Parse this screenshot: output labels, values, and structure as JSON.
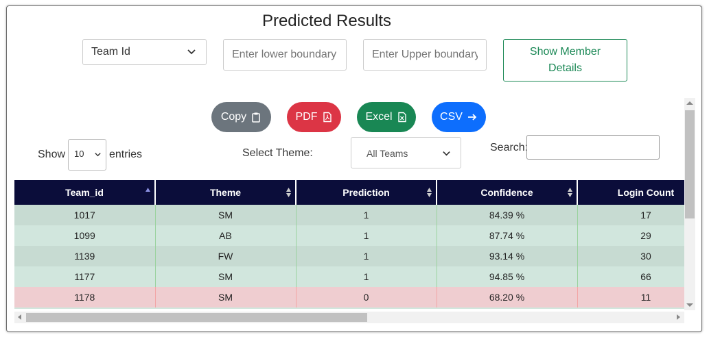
{
  "page": {
    "title": "Predicted Results"
  },
  "filters": {
    "field_select": "Team Id",
    "lower_placeholder": "Enter lower boundary",
    "upper_placeholder": "Enter Upper boundary",
    "show_member_line1": "Show Member",
    "show_member_line2": "Details"
  },
  "export": {
    "copy": "Copy",
    "pdf": "PDF",
    "excel": "Excel",
    "csv": "CSV",
    "colors": {
      "copy": "#6c757d",
      "pdf": "#dc3545",
      "excel": "#198754",
      "csv": "#0d6efd"
    }
  },
  "controls": {
    "show_label": "Show",
    "entries_value": "10",
    "entries_label": "entries",
    "theme_label": "Select Theme:",
    "theme_value": "All Teams",
    "search_label": "Search:",
    "search_value": ""
  },
  "table": {
    "columns": [
      "Team_id",
      "Theme",
      "Prediction",
      "Confidence",
      "Login Count"
    ],
    "rows": [
      [
        "1017",
        "SM",
        "1",
        "84.39 %",
        "17"
      ],
      [
        "1099",
        "AB",
        "1",
        "87.74 %",
        "29"
      ],
      [
        "1139",
        "FW",
        "1",
        "93.14 %",
        "30"
      ],
      [
        "1177",
        "SM",
        "1",
        "94.85 %",
        "66"
      ],
      [
        "1178",
        "SM",
        "0",
        "68.20 %",
        "11"
      ]
    ]
  },
  "colors": {
    "header_bg": "#0b0d3a",
    "positive_row": "#c7dbd2",
    "negative_row": "#efcdd0"
  }
}
